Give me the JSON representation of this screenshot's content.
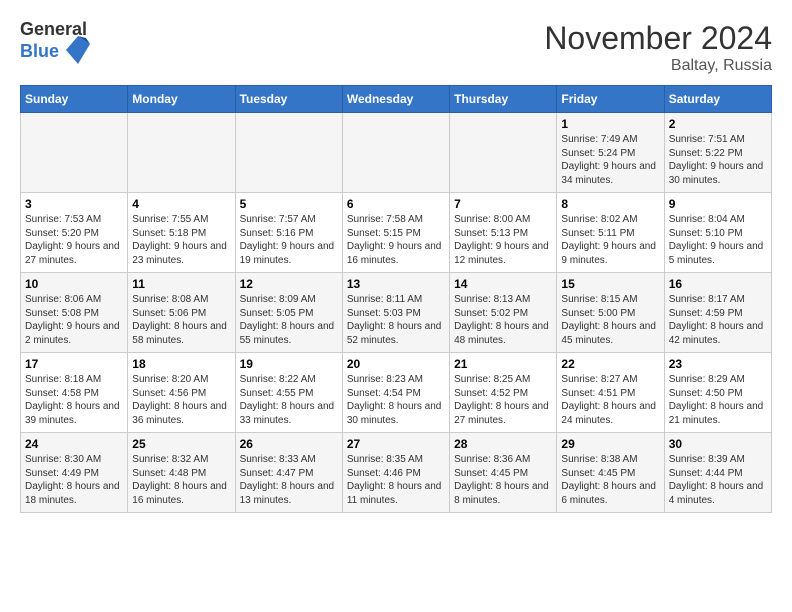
{
  "header": {
    "logo_general": "General",
    "logo_blue": "Blue",
    "month_title": "November 2024",
    "location": "Baltay, Russia"
  },
  "weekdays": [
    "Sunday",
    "Monday",
    "Tuesday",
    "Wednesday",
    "Thursday",
    "Friday",
    "Saturday"
  ],
  "weeks": [
    [
      {
        "day": "",
        "info": ""
      },
      {
        "day": "",
        "info": ""
      },
      {
        "day": "",
        "info": ""
      },
      {
        "day": "",
        "info": ""
      },
      {
        "day": "",
        "info": ""
      },
      {
        "day": "1",
        "info": "Sunrise: 7:49 AM\nSunset: 5:24 PM\nDaylight: 9 hours and 34 minutes."
      },
      {
        "day": "2",
        "info": "Sunrise: 7:51 AM\nSunset: 5:22 PM\nDaylight: 9 hours and 30 minutes."
      }
    ],
    [
      {
        "day": "3",
        "info": "Sunrise: 7:53 AM\nSunset: 5:20 PM\nDaylight: 9 hours and 27 minutes."
      },
      {
        "day": "4",
        "info": "Sunrise: 7:55 AM\nSunset: 5:18 PM\nDaylight: 9 hours and 23 minutes."
      },
      {
        "day": "5",
        "info": "Sunrise: 7:57 AM\nSunset: 5:16 PM\nDaylight: 9 hours and 19 minutes."
      },
      {
        "day": "6",
        "info": "Sunrise: 7:58 AM\nSunset: 5:15 PM\nDaylight: 9 hours and 16 minutes."
      },
      {
        "day": "7",
        "info": "Sunrise: 8:00 AM\nSunset: 5:13 PM\nDaylight: 9 hours and 12 minutes."
      },
      {
        "day": "8",
        "info": "Sunrise: 8:02 AM\nSunset: 5:11 PM\nDaylight: 9 hours and 9 minutes."
      },
      {
        "day": "9",
        "info": "Sunrise: 8:04 AM\nSunset: 5:10 PM\nDaylight: 9 hours and 5 minutes."
      }
    ],
    [
      {
        "day": "10",
        "info": "Sunrise: 8:06 AM\nSunset: 5:08 PM\nDaylight: 9 hours and 2 minutes."
      },
      {
        "day": "11",
        "info": "Sunrise: 8:08 AM\nSunset: 5:06 PM\nDaylight: 8 hours and 58 minutes."
      },
      {
        "day": "12",
        "info": "Sunrise: 8:09 AM\nSunset: 5:05 PM\nDaylight: 8 hours and 55 minutes."
      },
      {
        "day": "13",
        "info": "Sunrise: 8:11 AM\nSunset: 5:03 PM\nDaylight: 8 hours and 52 minutes."
      },
      {
        "day": "14",
        "info": "Sunrise: 8:13 AM\nSunset: 5:02 PM\nDaylight: 8 hours and 48 minutes."
      },
      {
        "day": "15",
        "info": "Sunrise: 8:15 AM\nSunset: 5:00 PM\nDaylight: 8 hours and 45 minutes."
      },
      {
        "day": "16",
        "info": "Sunrise: 8:17 AM\nSunset: 4:59 PM\nDaylight: 8 hours and 42 minutes."
      }
    ],
    [
      {
        "day": "17",
        "info": "Sunrise: 8:18 AM\nSunset: 4:58 PM\nDaylight: 8 hours and 39 minutes."
      },
      {
        "day": "18",
        "info": "Sunrise: 8:20 AM\nSunset: 4:56 PM\nDaylight: 8 hours and 36 minutes."
      },
      {
        "day": "19",
        "info": "Sunrise: 8:22 AM\nSunset: 4:55 PM\nDaylight: 8 hours and 33 minutes."
      },
      {
        "day": "20",
        "info": "Sunrise: 8:23 AM\nSunset: 4:54 PM\nDaylight: 8 hours and 30 minutes."
      },
      {
        "day": "21",
        "info": "Sunrise: 8:25 AM\nSunset: 4:52 PM\nDaylight: 8 hours and 27 minutes."
      },
      {
        "day": "22",
        "info": "Sunrise: 8:27 AM\nSunset: 4:51 PM\nDaylight: 8 hours and 24 minutes."
      },
      {
        "day": "23",
        "info": "Sunrise: 8:29 AM\nSunset: 4:50 PM\nDaylight: 8 hours and 21 minutes."
      }
    ],
    [
      {
        "day": "24",
        "info": "Sunrise: 8:30 AM\nSunset: 4:49 PM\nDaylight: 8 hours and 18 minutes."
      },
      {
        "day": "25",
        "info": "Sunrise: 8:32 AM\nSunset: 4:48 PM\nDaylight: 8 hours and 16 minutes."
      },
      {
        "day": "26",
        "info": "Sunrise: 8:33 AM\nSunset: 4:47 PM\nDaylight: 8 hours and 13 minutes."
      },
      {
        "day": "27",
        "info": "Sunrise: 8:35 AM\nSunset: 4:46 PM\nDaylight: 8 hours and 11 minutes."
      },
      {
        "day": "28",
        "info": "Sunrise: 8:36 AM\nSunset: 4:45 PM\nDaylight: 8 hours and 8 minutes."
      },
      {
        "day": "29",
        "info": "Sunrise: 8:38 AM\nSunset: 4:45 PM\nDaylight: 8 hours and 6 minutes."
      },
      {
        "day": "30",
        "info": "Sunrise: 8:39 AM\nSunset: 4:44 PM\nDaylight: 8 hours and 4 minutes."
      }
    ]
  ]
}
